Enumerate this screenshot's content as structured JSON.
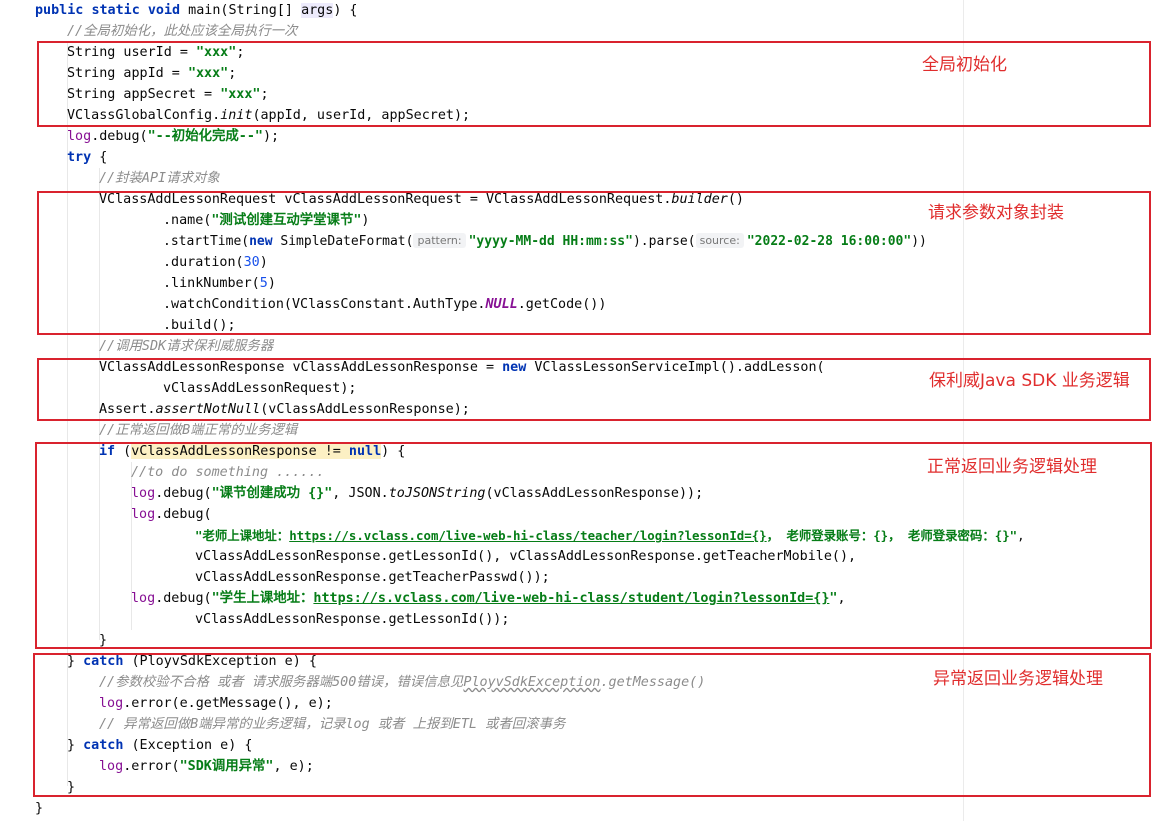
{
  "code": {
    "l01": {
      "kw1": "public",
      "kw2": "static",
      "kw3": "void",
      "rest1": " main(String[] ",
      "param": "args",
      "rest2": ") {"
    },
    "l02": {
      "comment": "//全局初始化，此处应该全局执行一次"
    },
    "l03": {
      "pre": "String userId = ",
      "str": "\"xxx\"",
      "post": ";"
    },
    "l04": {
      "pre": "String appId = ",
      "str": "\"xxx\"",
      "post": ";"
    },
    "l05": {
      "pre": "String appSecret = ",
      "str": "\"xxx\"",
      "post": ";"
    },
    "l06": {
      "pre": "VClassGlobalConfig.",
      "ital": "init",
      "post": "(appId, userId, appSecret);"
    },
    "l07": {
      "log": "log",
      "pre": ".debug(",
      "str": "\"--初始化完成--\"",
      "post": ");"
    },
    "l08": {
      "kw": "try",
      "post": " {"
    },
    "l09": {
      "comment": "//封装API请求对象"
    },
    "l10": {
      "pre": "VClassAddLessonRequest vClassAddLessonRequest = VClassAddLessonRequest.",
      "ital": "builder",
      "post": "()"
    },
    "l11": {
      "pre": ".name(",
      "str": "\"测试创建互动学堂课节\"",
      "post": ")"
    },
    "l12": {
      "pre": ".startTime(",
      "kw": "new",
      "mid": " SimpleDateFormat(",
      "hint1": "pattern:",
      "str1": "\"yyyy-MM-dd HH:mm:ss\"",
      "mid2": ").parse(",
      "hint2": "source:",
      "str2": "\"2022-02-28 16:00:00\"",
      "post": "))"
    },
    "l13": {
      "pre": ".duration(",
      "num": "30",
      "post": ")"
    },
    "l14": {
      "pre": ".linkNumber(",
      "num": "5",
      "post": ")"
    },
    "l15": {
      "pre": ".watchCondition(VClassConstant.AuthType.",
      "fld": "NULL",
      "post": ".getCode())"
    },
    "l16": {
      "pre": ".build();"
    },
    "l17": {
      "comment": "//调用SDK请求保利威服务器"
    },
    "l18": {
      "pre": "VClassAddLessonResponse vClassAddLessonResponse = ",
      "kw": "new",
      "post": " VClassLessonServiceImpl().addLesson("
    },
    "l19": {
      "pre": "vClassAddLessonRequest);"
    },
    "l20": {
      "pre": "Assert.",
      "ital": "assertNotNull",
      "post": "(vClassAddLessonResponse);"
    },
    "l21": {
      "comment": "//正常返回做B端正常的业务逻辑"
    },
    "l22": {
      "kw": "if",
      "mid": " (",
      "hl1": "vClassAddLessonResponse != ",
      "kw2": "null",
      "post": ") {"
    },
    "l23": {
      "comment": "//to do something ......"
    },
    "l24": {
      "log": "log",
      "pre": ".debug(",
      "str": "\"课节创建成功 {}\"",
      "mid": ", JSON.",
      "ital": "toJSONString",
      "post": "(vClassAddLessonResponse));"
    },
    "l25": {
      "log": "log",
      "pre": ".debug("
    },
    "l26": {
      "s1": "\"老师上课地址：",
      "link": "https://s.vclass.com/live-web-hi-class/teacher/login?lessonId={}",
      "s2": "， 老师登录账号：{}， 老师登录密码：{}\"",
      "post": ","
    },
    "l27": {
      "pre": "vClassAddLessonResponse.getLessonId(), vClassAddLessonResponse.getTeacherMobile(),"
    },
    "l28": {
      "pre": "vClassAddLessonResponse.getTeacherPasswd());"
    },
    "l29": {
      "log": "log",
      "pre": ".debug(",
      "s1": "\"学生上课地址：",
      "link": "https://s.vclass.com/live-web-hi-class/student/login?lessonId={}",
      "s2": "\"",
      "post": ","
    },
    "l30": {
      "pre": "vClassAddLessonResponse.getLessonId());"
    },
    "l31": {
      "pre": "}"
    },
    "l32": {
      "pre": "} ",
      "kw": "catch",
      "post": " (PloyvSdkException e) {"
    },
    "l33": {
      "comment1": "//参数校验不合格 或者 请求服务器端500错误，错误信息见",
      "wavy": "PloyvSdkException",
      "comment2": ".getMessage()"
    },
    "l34": {
      "log": "log",
      "pre": ".error(e.getMessage(), e);"
    },
    "l35": {
      "comment": "// 异常返回做B端异常的业务逻辑，记录log 或者 上报到ETL 或者回滚事务"
    },
    "l36": {
      "pre": "} ",
      "kw": "catch",
      "post": " (Exception e) {"
    },
    "l37": {
      "log": "log",
      "pre": ".error(",
      "str": "\"SDK调用异常\"",
      "post": ", e);"
    },
    "l38": {
      "pre": "}"
    },
    "l39": {
      "pre": "}"
    }
  },
  "annotations": {
    "global_init": "全局初始化",
    "request_wrap": "请求参数对象封装",
    "sdk_logic": "保利威Java SDK 业务逻辑",
    "normal_return": "正常返回业务逻辑处理",
    "error_return": "异常返回业务逻辑处理"
  },
  "colors": {
    "keyword": "#0033b3",
    "string": "#067d17",
    "comment": "#8c8c8c",
    "number": "#1750eb",
    "field": "#871094",
    "annotation_red": "#d9232e"
  }
}
